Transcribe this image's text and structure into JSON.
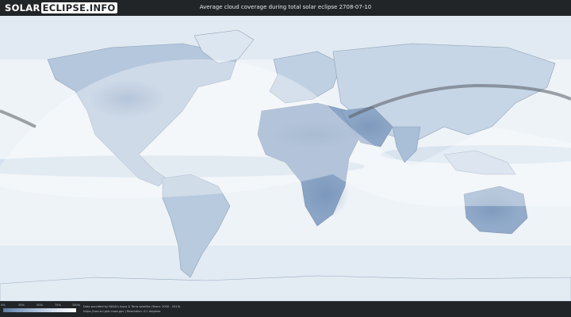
{
  "header": {
    "logo_part1": "SOLAR",
    "logo_part2": "ECLIPSE.INFO",
    "title": "Average cloud coverage during total solar eclipse 2708-07-10"
  },
  "legend": {
    "labels": [
      "0%",
      "25%",
      "50%",
      "75%",
      "100%"
    ],
    "colors": [
      "#5f7ea4",
      "#98b1ce",
      "#cfdcea",
      "#ffffff"
    ]
  },
  "footer": {
    "credit_line1": "Data provided by NASA's Aqua & Terra satellite (Years: 2000 - 2019)",
    "credit_line2": "https://neo.sci.gsfc.nasa.gov | Resolution: 0.1 degrees"
  }
}
